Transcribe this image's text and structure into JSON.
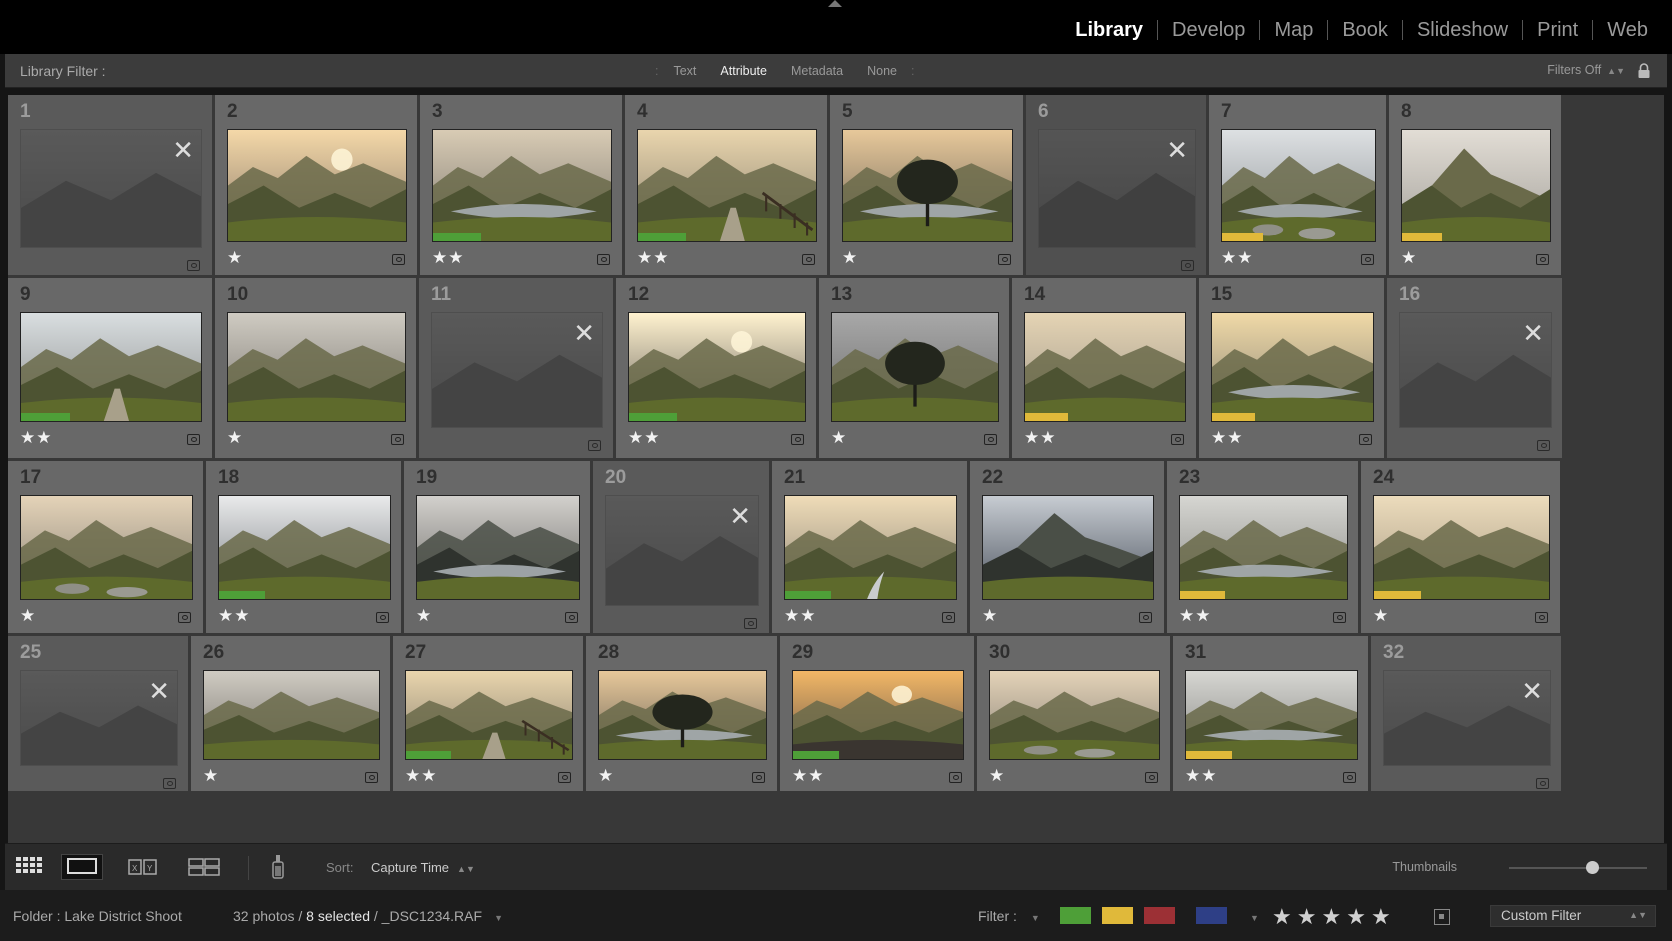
{
  "modules": {
    "items": [
      {
        "label": "Library",
        "active": true
      },
      {
        "label": "Develop"
      },
      {
        "label": "Map"
      },
      {
        "label": "Book"
      },
      {
        "label": "Slideshow"
      },
      {
        "label": "Print"
      },
      {
        "label": "Web"
      }
    ]
  },
  "filter_bar": {
    "label": "Library Filter :",
    "tabs": [
      {
        "label": "Text"
      },
      {
        "label": "Attribute",
        "active": true
      },
      {
        "label": "Metadata"
      },
      {
        "label": "None"
      }
    ],
    "filters_off": "Filters Off",
    "icon": "lock-icon"
  },
  "colors": {
    "green": "#4e9f38",
    "yellow": "#e0b93a",
    "red": "#9c3035",
    "blue": "#2e3f86",
    "cell": "#686868",
    "rejected_cell": "#505050"
  },
  "grid": {
    "photos": [
      {
        "n": "1",
        "rejected": true,
        "selected": true
      },
      {
        "n": "2",
        "stars": "★",
        "scene": "sunset-valley"
      },
      {
        "n": "3",
        "stars": "★★",
        "label": "green",
        "scene": "lake-valley"
      },
      {
        "n": "4",
        "stars": "★★",
        "label": "green",
        "scene": "path-fence"
      },
      {
        "n": "5",
        "stars": "★",
        "scene": "tree-lake"
      },
      {
        "n": "6",
        "rejected": true
      },
      {
        "n": "7",
        "stars": "★★",
        "label": "yellow",
        "scene": "lake-rocks"
      },
      {
        "n": "8",
        "stars": "★",
        "label": "yellow",
        "scene": "peak"
      },
      {
        "n": "9",
        "stars": "★★",
        "label": "green",
        "scene": "path-valley"
      },
      {
        "n": "10",
        "stars": "★",
        "scene": "misty-valley"
      },
      {
        "n": "11",
        "rejected": true,
        "selected": true
      },
      {
        "n": "12",
        "stars": "★★",
        "label": "green",
        "scene": "sunburst-valley"
      },
      {
        "n": "13",
        "stars": "★",
        "scene": "tree-hill"
      },
      {
        "n": "14",
        "stars": "★★",
        "label": "yellow",
        "scene": "wide-valley"
      },
      {
        "n": "15",
        "stars": "★★",
        "label": "yellow",
        "scene": "lake-shore"
      },
      {
        "n": "16",
        "rejected": true,
        "selected": true
      },
      {
        "n": "17",
        "stars": "★",
        "scene": "rocky-valley"
      },
      {
        "n": "18",
        "stars": "★★",
        "label": "green",
        "scene": "cloud-peaks"
      },
      {
        "n": "19",
        "stars": "★",
        "scene": "dark-lake"
      },
      {
        "n": "20",
        "rejected": true,
        "selected": true
      },
      {
        "n": "21",
        "stars": "★★",
        "label": "green",
        "scene": "stream-valley"
      },
      {
        "n": "22",
        "stars": "★",
        "scene": "storm-peak"
      },
      {
        "n": "23",
        "stars": "★★",
        "label": "yellow",
        "scene": "wide-lake"
      },
      {
        "n": "24",
        "stars": "★",
        "label": "yellow",
        "scene": "green-valley"
      },
      {
        "n": "25",
        "rejected": true,
        "selected": true
      },
      {
        "n": "26",
        "stars": "★",
        "scene": "misty-valley"
      },
      {
        "n": "27",
        "stars": "★★",
        "label": "green",
        "scene": "path-fence"
      },
      {
        "n": "28",
        "stars": "★",
        "scene": "tree-lake"
      },
      {
        "n": "29",
        "stars": "★★",
        "label": "green",
        "scene": "sunset-peaks"
      },
      {
        "n": "30",
        "stars": "★",
        "scene": "rocky-valley"
      },
      {
        "n": "31",
        "stars": "★★",
        "label": "yellow",
        "scene": "wide-lake"
      },
      {
        "n": "32",
        "rejected": true,
        "selected": true
      }
    ]
  },
  "toolbar": {
    "sort_label": "Sort:",
    "sort_value": "Capture Time",
    "thumbnails_label": "Thumbnails",
    "thumbnail_size": 0.6,
    "icons": [
      "grid-view-icon",
      "loupe-view-icon",
      "compare-view-icon",
      "survey-view-icon",
      "painter-icon"
    ]
  },
  "status": {
    "folder": "Folder : Lake District Shoot",
    "photos": "32 photos /",
    "selected": "8 selected",
    "file": "/ _DSC1234.RAF",
    "filter_label": "Filter :",
    "stars": "★★★★★",
    "custom_filter": "Custom Filter"
  }
}
